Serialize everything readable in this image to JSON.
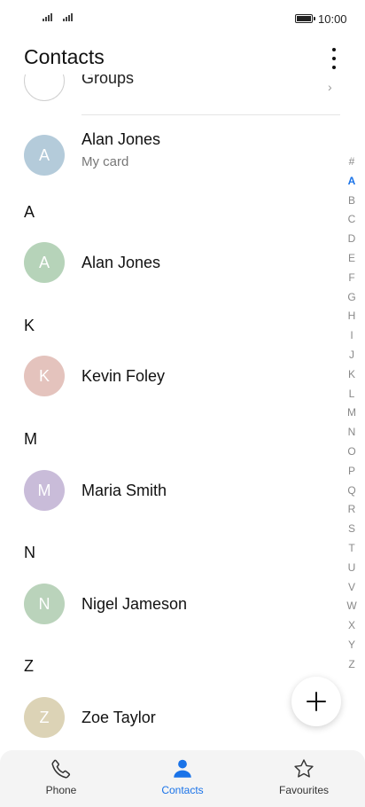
{
  "status": {
    "time": "10:00"
  },
  "header": {
    "title": "Contacts"
  },
  "groups": {
    "label": "Groups"
  },
  "my_card": {
    "initial": "A",
    "name": "Alan Jones",
    "subtitle": "My card",
    "color": "#b4cbda"
  },
  "sections": [
    {
      "letter": "A",
      "contacts": [
        {
          "initial": "A",
          "name": "Alan Jones",
          "color": "#b6d3b9"
        }
      ]
    },
    {
      "letter": "K",
      "contacts": [
        {
          "initial": "K",
          "name": "Kevin Foley",
          "color": "#e4c3bd"
        }
      ]
    },
    {
      "letter": "M",
      "contacts": [
        {
          "initial": "M",
          "name": "Maria Smith",
          "color": "#c9bcd9"
        }
      ]
    },
    {
      "letter": "N",
      "contacts": [
        {
          "initial": "N",
          "name": "Nigel Jameson",
          "color": "#bad3bb"
        }
      ]
    },
    {
      "letter": "Z",
      "contacts": [
        {
          "initial": "Z",
          "name": "Zoe Taylor",
          "color": "#dcd3b6"
        }
      ]
    }
  ],
  "index_letters": [
    "#",
    "A",
    "B",
    "C",
    "D",
    "E",
    "F",
    "G",
    "H",
    "I",
    "J",
    "K",
    "L",
    "M",
    "N",
    "O",
    "P",
    "Q",
    "R",
    "S",
    "T",
    "U",
    "V",
    "W",
    "X",
    "Y",
    "Z"
  ],
  "index_active": "A",
  "fab": {
    "icon": "plus-icon"
  },
  "bottom_nav": [
    {
      "label": "Phone",
      "icon": "phone-icon",
      "active": false
    },
    {
      "label": "Contacts",
      "icon": "person-icon",
      "active": true
    },
    {
      "label": "Favourites",
      "icon": "star-icon",
      "active": false
    }
  ],
  "colors": {
    "accent": "#1a73e8",
    "nav_bg": "#f4f4f4"
  }
}
